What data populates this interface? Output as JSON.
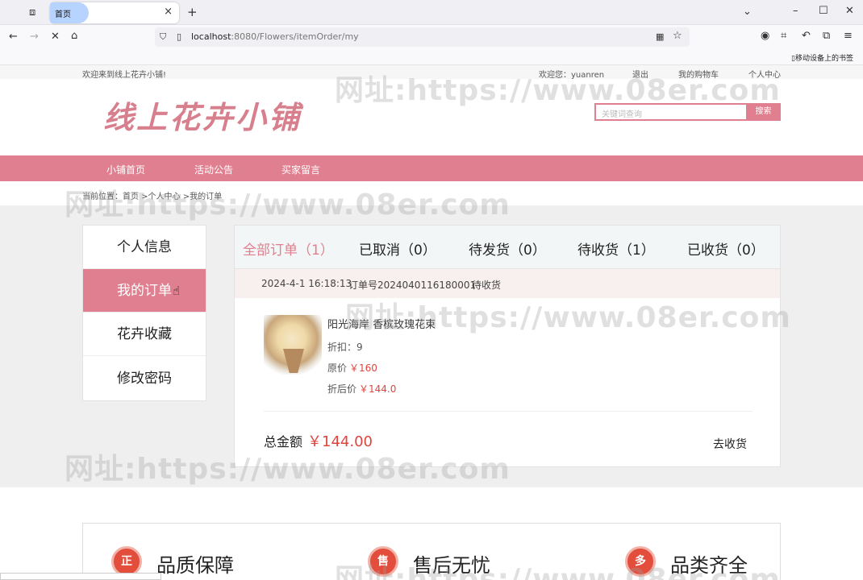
{
  "browser": {
    "tab_title": "首页",
    "url_host": "localhost",
    "url_rest": ":8080/Flowers/itemOrder/my",
    "bookmark_label": "移动设备上的书签"
  },
  "site": {
    "welcome": "欢迎来到线上花卉小铺!",
    "user_greeting": "欢迎您：yuanren",
    "logout": "退出",
    "cart": "我的购物车",
    "personal_center": "个人中心",
    "logo_text": "线上花卉小铺",
    "search_placeholder": "关键词查询",
    "search_button": "搜索",
    "menu": [
      "小铺首页",
      "活动公告",
      "买家留言"
    ],
    "breadcrumb": "当前位置：首页 >个人中心 >我的订单"
  },
  "sidebar": {
    "items": [
      "个人信息",
      "我的订单",
      "花卉收藏",
      "修改密码"
    ],
    "active_index": 1
  },
  "order_tabs": [
    "全部订单（1）",
    "已取消（0）",
    "待发货（0）",
    "待收货（1）",
    "已收货（0）"
  ],
  "order": {
    "date": "2024-4-1 16:18:13",
    "order_no": "订单号2024040116180001",
    "status": "待收货",
    "product_name": "阳光海岸 香槟玫瑰花束",
    "discount_label": "折扣：9",
    "price_label": "原价",
    "price": "￥160",
    "final_label": "折后价",
    "final_price": "￥144.0",
    "total_label": "总金额",
    "total_amount": "￥144.00",
    "action": "去收货"
  },
  "features": [
    "品质保障",
    "售后无忧",
    "品类齐全"
  ],
  "feature_icons": [
    "正",
    "售",
    "多"
  ],
  "watermark": "网址:https://www.08er.com",
  "colors": {
    "accent": "#e07f8f",
    "price": "#e0443e"
  }
}
